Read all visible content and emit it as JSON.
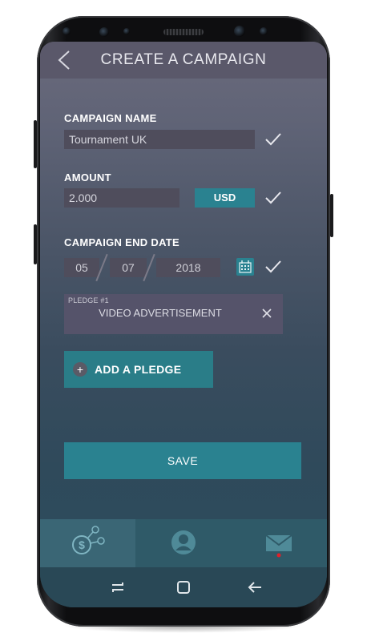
{
  "header": {
    "title": "CREATE A CAMPAIGN"
  },
  "form": {
    "campaign_name_label": "CAMPAIGN NAME",
    "campaign_name_value": "Tournament UK",
    "amount_label": "AMOUNT",
    "amount_value": "2.000",
    "currency": "USD",
    "end_date_label": "CAMPAIGN END DATE",
    "end_date": {
      "day": "05",
      "month": "07",
      "year": "2018"
    }
  },
  "pledges": [
    {
      "label": "PLEDGE #1",
      "text": "VIDEO ADVERTISEMENT"
    }
  ],
  "add_pledge_label": "ADD A PLEDGE",
  "add_pledge_icon": "+",
  "save_label": "SAVE",
  "tabs": [
    {
      "icon": "dollar-network-icon",
      "active": true
    },
    {
      "icon": "user-icon",
      "active": false
    },
    {
      "icon": "mail-icon",
      "active": false,
      "notification": true
    }
  ],
  "navbar": [
    "recent-apps-icon",
    "home-icon",
    "back-arrow-icon"
  ],
  "colors": {
    "accent": "#2a8290",
    "field_bg": "#4f4d5c",
    "header_bg": "#5a586a",
    "notification": "#e0202a"
  }
}
